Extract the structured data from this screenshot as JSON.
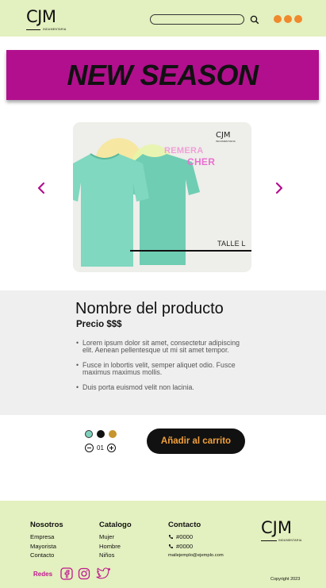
{
  "header": {
    "logo_text": "CJM",
    "logo_sub": "INDUMENTARIA",
    "search_placeholder": "",
    "icons": [
      "search-icon",
      "menu-dots-icon"
    ],
    "accent_dots_color": "#f0892c",
    "background": "#e3f0bf"
  },
  "banner": {
    "title": "NEW SEASON",
    "background": "#b20f8e"
  },
  "carousel": {
    "card_logo": "CJM",
    "card_logo_sub": "INDUMENTARIA",
    "brand_line1": "REMERA",
    "brand_line2": "CHER",
    "size_label": "TALLE L",
    "shirt_color": "#7fd8bf",
    "icons": [
      "chevron-left-icon",
      "chevron-right-icon"
    ],
    "arrow_color": "#b20f8e"
  },
  "product": {
    "name": "Nombre del producto",
    "price": "Precio $$$",
    "bullets": [
      "Lorem ipsum dolor sit amet, consectetur adipiscing elit. Aenean pellentesque ut mi sit amet tempor.",
      "Fusce in lobortis velit, semper aliquet odio. Fusce maximus maximus mollis.",
      "Duis porta euismod velit non lacinia."
    ],
    "colors": [
      "#7fd1bd",
      "#111111",
      "#c6952f"
    ],
    "quantity": "01",
    "cart_button": "Añadir al carrito"
  },
  "footer": {
    "col1": {
      "title": "Nosotros",
      "links": [
        "Empresa",
        "Mayorista",
        "Contacto"
      ]
    },
    "col2": {
      "title": "Catalogo",
      "links": [
        "Mujer",
        "Hombre",
        "Niños"
      ]
    },
    "col3": {
      "title": "Contacto",
      "phones": [
        "#0000",
        "#0000"
      ],
      "email": "mailejemplo@ejemplo.com"
    },
    "logo_text": "CJM",
    "logo_sub": "INDUMENTARIA",
    "social_label": "Redes",
    "social_icons": [
      "facebook-icon",
      "instagram-icon",
      "twitter-icon"
    ],
    "copyright": "Copyright 2023",
    "accent": "#c0168f"
  }
}
